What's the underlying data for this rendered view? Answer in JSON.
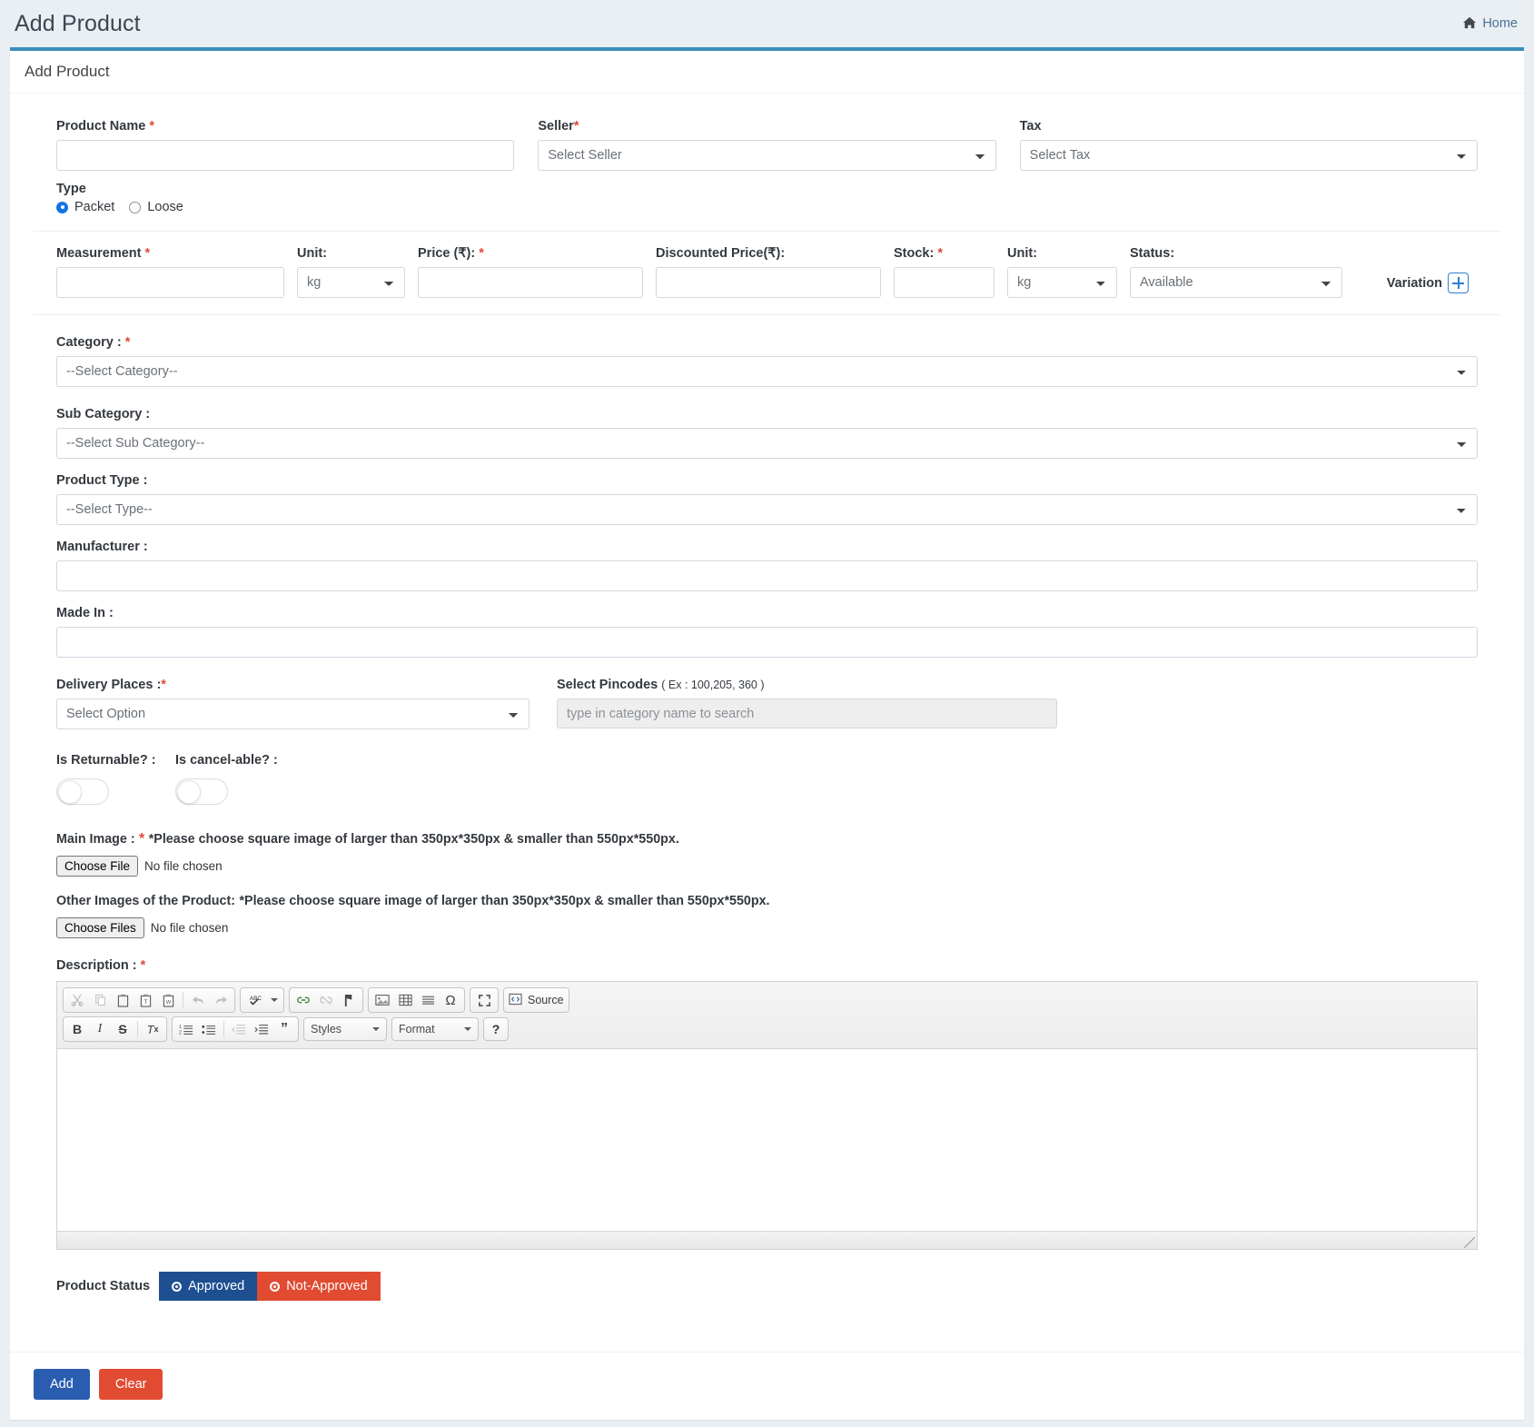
{
  "header": {
    "title": "Add Product",
    "breadcrumb_home": "Home",
    "home_icon": "home-icon"
  },
  "card": {
    "title": "Add Product"
  },
  "form": {
    "product_name": {
      "label": "Product Name",
      "required": "*",
      "value": "",
      "placeholder": ""
    },
    "seller": {
      "label": "Seller",
      "required": "*",
      "selected": "Select Seller"
    },
    "tax": {
      "label": "Tax",
      "required": "",
      "selected": "Select Tax"
    },
    "type": {
      "label": "Type",
      "options": [
        {
          "label": "Packet",
          "selected": true
        },
        {
          "label": "Loose",
          "selected": false
        }
      ]
    },
    "measurement": {
      "label": "Measurement",
      "required": "*",
      "value": ""
    },
    "unit1": {
      "label": "Unit:",
      "selected": "kg"
    },
    "price": {
      "label": "Price (₹):",
      "required": "*",
      "value": ""
    },
    "discounted_price": {
      "label": "Discounted Price(₹):",
      "required": "",
      "value": ""
    },
    "stock": {
      "label": "Stock:",
      "required": "*",
      "value": ""
    },
    "unit2": {
      "label": "Unit:",
      "selected": "kg"
    },
    "status": {
      "label": "Status:",
      "selected": "Available"
    },
    "variation": {
      "label": "Variation",
      "icon": "plus-square-icon"
    },
    "category": {
      "label": "Category :",
      "required": "*",
      "selected": "--Select Category--"
    },
    "sub_category": {
      "label": "Sub Category :",
      "required": "",
      "selected": "--Select Sub Category--"
    },
    "product_type": {
      "label": "Product Type :",
      "required": "",
      "selected": "--Select Type--"
    },
    "manufacturer": {
      "label": "Manufacturer :",
      "value": ""
    },
    "made_in": {
      "label": "Made In :",
      "value": ""
    },
    "delivery_places": {
      "label": "Delivery Places :",
      "required": "*",
      "selected": "Select Option"
    },
    "pincodes": {
      "label": "Select Pincodes",
      "note": "( Ex : 100,205, 360 )",
      "placeholder": "type in category name to search",
      "value": ""
    },
    "is_returnable": {
      "label": "Is Returnable? :",
      "on": false
    },
    "is_cancelable": {
      "label": "Is cancel-able? :",
      "on": false
    },
    "main_image": {
      "label": "Main Image :",
      "required": "*",
      "hint": "*Please choose square image of larger than 350px*350px & smaller than 550px*550px.",
      "button": "Choose File",
      "file_status": "No file chosen"
    },
    "other_images": {
      "label": "Other Images of the Product:",
      "hint": "*Please choose square image of larger than 350px*350px & smaller than 550px*550px.",
      "button": "Choose Files",
      "file_status": "No file chosen"
    },
    "description": {
      "label": "Description :",
      "required": "*",
      "value": ""
    }
  },
  "editor": {
    "row1": [
      {
        "group": [
          {
            "name": "cut-icon",
            "glyph": "✂",
            "disabled": true
          },
          {
            "name": "copy-icon",
            "glyph": "❐",
            "disabled": true
          },
          {
            "name": "paste-icon",
            "glyph": "📋",
            "disabled": false
          },
          {
            "name": "paste-as-plain-text-icon",
            "glyph": "📋",
            "disabled": false
          },
          {
            "name": "paste-from-word-icon",
            "glyph": "📋",
            "disabled": false
          },
          {
            "name": "separator",
            "glyph": "",
            "disabled": false
          },
          {
            "name": "undo-icon",
            "glyph": "↩",
            "disabled": true
          },
          {
            "name": "redo-icon",
            "glyph": "↪",
            "disabled": true
          }
        ]
      },
      {
        "group": [
          {
            "name": "spell-check-icon",
            "glyph": "ABC",
            "disabled": false
          }
        ]
      },
      {
        "group": [
          {
            "name": "link-icon",
            "glyph": "🔗",
            "disabled": false
          },
          {
            "name": "unlink-icon",
            "glyph": "🔗",
            "disabled": true
          },
          {
            "name": "anchor-icon",
            "glyph": "⚑",
            "disabled": false
          }
        ]
      },
      {
        "group": [
          {
            "name": "image-icon",
            "glyph": "🖼",
            "disabled": false
          },
          {
            "name": "table-icon",
            "glyph": "▦",
            "disabled": false
          },
          {
            "name": "horizontal-rule-icon",
            "glyph": "☰",
            "disabled": false
          },
          {
            "name": "special-character-icon",
            "glyph": "Ω",
            "disabled": false
          }
        ]
      },
      {
        "group": [
          {
            "name": "maximize-icon",
            "glyph": "⤢",
            "disabled": false
          }
        ]
      },
      {
        "group": [
          {
            "name": "source-button",
            "glyph": "◈",
            "disabled": false
          }
        ]
      }
    ],
    "source_label": "Source",
    "row2": [
      {
        "group": [
          {
            "name": "bold-icon",
            "glyph": "B",
            "disabled": false
          },
          {
            "name": "italic-icon",
            "glyph": "I",
            "disabled": false
          },
          {
            "name": "strikethrough-icon",
            "glyph": "S",
            "disabled": false
          },
          {
            "name": "remove-format-icon",
            "glyph": "Tx",
            "disabled": false
          }
        ]
      },
      {
        "group": [
          {
            "name": "numbered-list-icon",
            "glyph": "1≡",
            "disabled": false
          },
          {
            "name": "bulleted-list-icon",
            "glyph": "•≡",
            "disabled": false
          },
          {
            "name": "decrease-indent-icon",
            "glyph": "⇤",
            "disabled": true
          },
          {
            "name": "increase-indent-icon",
            "glyph": "⇥",
            "disabled": false
          },
          {
            "name": "blockquote-icon",
            "glyph": "❞",
            "disabled": false
          }
        ]
      }
    ],
    "styles_label": "Styles",
    "format_label": "Format",
    "help_label": "?"
  },
  "product_status": {
    "label": "Product Status",
    "approved": "Approved",
    "not_approved": "Not-Approved",
    "approved_color": "#1d4f91",
    "not_approved_color": "#e04b32"
  },
  "footer": {
    "add_label": "Add",
    "clear_label": "Clear",
    "add_color": "#2a5db0",
    "clear_color": "#e04b32"
  },
  "theme": {
    "accent": "#3c8dbc",
    "page_bg": "#eaeff4",
    "required_color": "#dd4b39"
  }
}
